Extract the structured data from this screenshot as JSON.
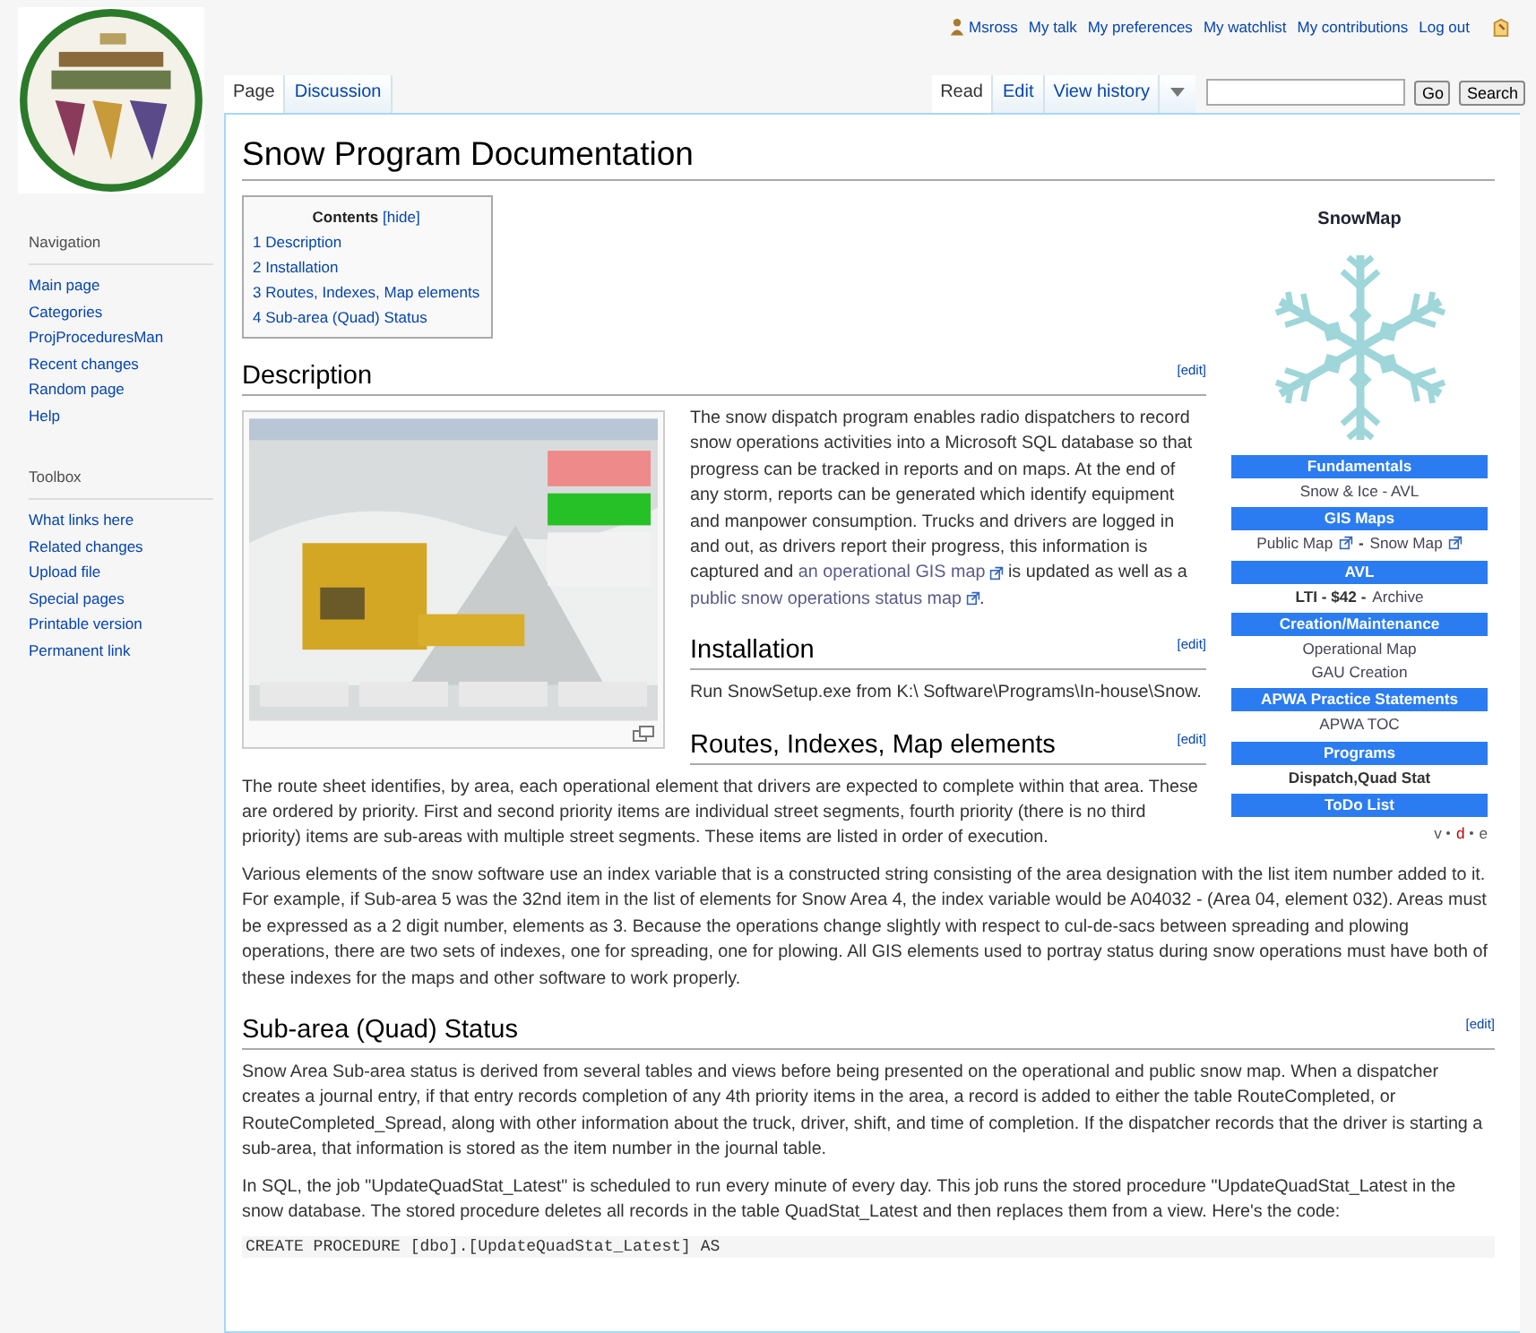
{
  "personal_menu": [
    {
      "label": "Msross",
      "kind": "user"
    },
    {
      "label": "My talk",
      "kind": "link"
    },
    {
      "label": "My preferences",
      "kind": "link"
    },
    {
      "label": "My watchlist",
      "kind": "link"
    },
    {
      "label": "My contributions",
      "kind": "link"
    },
    {
      "label": "Log out",
      "kind": "link"
    }
  ],
  "sidebar": [
    {
      "heading": "Navigation",
      "items": [
        "Main page",
        "Categories",
        "ProjProceduresMan",
        "Recent changes",
        "Random page",
        "Help"
      ]
    },
    {
      "heading": "Toolbox",
      "items": [
        "What links here",
        "Related changes",
        "Upload file",
        "Special pages",
        "Printable version",
        "Permanent link"
      ]
    }
  ],
  "page_tabs": [
    {
      "label": "Page",
      "selected": true
    },
    {
      "label": "Discussion",
      "selected": false
    }
  ],
  "view_tabs": [
    {
      "label": "Read",
      "selected": true
    },
    {
      "label": "Edit",
      "selected": false
    },
    {
      "label": "View history",
      "selected": false
    }
  ],
  "search": {
    "buttons": [
      "Go",
      "Search"
    ]
  },
  "title": "Snow Program Documentation",
  "toc": {
    "title": "Contents",
    "toggle": "[hide]",
    "items": [
      {
        "number": "1",
        "label": "Description"
      },
      {
        "number": "2",
        "label": "Installation"
      },
      {
        "number": "3",
        "label": "Routes, Indexes, Map elements"
      },
      {
        "number": "4",
        "label": "Sub-area (Quad) Status"
      }
    ]
  },
  "infobox": {
    "title": "SnowMap",
    "groups": [
      {
        "heading": "Fundamentals",
        "lines": [
          [
            {
              "text": "Snow & Ice - AVL",
              "kind": "link"
            }
          ]
        ]
      },
      {
        "heading": "GIS Maps",
        "lines": [
          [
            {
              "text": "Public Map",
              "kind": "external_link"
            },
            {
              "text": " - ",
              "kind": "text"
            },
            {
              "text": "Snow Map",
              "kind": "external_link"
            }
          ]
        ]
      },
      {
        "heading": "AVL",
        "lines": [
          [
            {
              "text": "LTI - $42 - ",
              "kind": "text"
            },
            {
              "text": "Archive",
              "kind": "link"
            }
          ]
        ]
      },
      {
        "heading": "Creation/Maintenance",
        "lines": [
          [
            {
              "text": "Operational Map",
              "kind": "link"
            }
          ],
          [
            {
              "text": "GAU Creation",
              "kind": "link"
            }
          ]
        ]
      },
      {
        "heading": "APWA Practice Statements",
        "lines": [
          [
            {
              "text": "APWA TOC",
              "kind": "link"
            }
          ]
        ]
      },
      {
        "heading": "Programs",
        "lines": [
          [
            {
              "text": "Dispatch,Quad Stat",
              "kind": "text"
            }
          ]
        ]
      },
      {
        "heading": "ToDo List"
      }
    ],
    "footer": [
      {
        "label": "v",
        "missing": false
      },
      {
        "label": "d",
        "missing": true
      },
      {
        "label": "e",
        "missing": false
      }
    ]
  },
  "sections": [
    {
      "heading": "Description",
      "edit": "[edit]",
      "figure": {
        "kind": "picture"
      },
      "blocks": [
        {
          "kind": "text",
          "parts": [
            {
              "text": "The snow dispatch program enables radio dispatchers to record snow operations activities into a Microsoft SQL database so that progress can be tracked in reports and on maps. At the end of any storm, reports can be generated which identify equipment and manpower consumption. Trucks and drivers are logged in and out, as drivers report their progress, this information is captured and ",
              "kind": "text"
            },
            {
              "text": "an operational GIS map",
              "kind": "external_link"
            },
            {
              "text": " is updated as well as a ",
              "kind": "text"
            },
            {
              "text": "public snow operations status map",
              "kind": "external_link"
            },
            {
              "text": ".",
              "kind": "text"
            }
          ]
        }
      ]
    },
    {
      "heading": "Installation",
      "edit": "[edit]",
      "blocks": [
        {
          "kind": "text",
          "parts": [
            {
              "text": "Run SnowSetup.exe from K:\\ Software\\Programs\\In-house\\Snow.",
              "kind": "text"
            }
          ]
        }
      ]
    },
    {
      "heading": "Routes, Indexes, Map elements",
      "edit": "[edit]",
      "blocks": [
        {
          "kind": "text",
          "parts": [
            {
              "text": "The route sheet identifies, by area, each operational element that drivers are expected to complete within that area. These are ordered by priority. First and second priority items are individual street segments, fourth priority (there is no third priority) items are sub-areas with multiple street segments. These items are listed in order of execution.",
              "kind": "text"
            }
          ]
        },
        {
          "kind": "text",
          "parts": [
            {
              "text": "Various elements of the snow software use an index variable that is a constructed string consisting of the area designation with the list item number added to it. For example, if Sub-area 5 was the 32nd item in the list of elements for Snow Area 4, the index variable would be A04032 - (Area 04, element 032). Areas must be expressed as a 2 digit number, elements as 3. Because the operations change slightly with respect to cul-de-sacs between spreading and plowing operations, there are two sets of indexes, one for spreading, one for plowing. All GIS elements used to portray status during snow operations must have both of these indexes for the maps and other software to work properly.",
              "kind": "text"
            }
          ]
        }
      ]
    },
    {
      "heading": "Sub-area (Quad) Status",
      "edit": "[edit]",
      "blocks": [
        {
          "kind": "text",
          "parts": [
            {
              "text": "Snow Area Sub-area status is derived from several tables and views before being presented on the operational and public snow map. When a dispatcher creates a journal entry, if that entry records completion of any 4th priority items in the area, a record is added to either the table RouteCompleted, or RouteCompleted_Spread, along with other information about the truck, driver, shift, and time of completion. If the dispatcher records that the driver is starting a sub-area, that information is stored as the item number in the journal table.",
              "kind": "text"
            }
          ]
        },
        {
          "kind": "text",
          "parts": [
            {
              "text": "In SQL, the job \"UpdateQuadStat_Latest\" is scheduled to run every minute of every day. This job runs the stored procedure \"UpdateQuadStat_Latest in the snow database. The stored procedure deletes all records in the table QuadStat_Latest and then replaces them from a view. Here's the code:",
              "kind": "text"
            }
          ]
        },
        {
          "kind": "code",
          "text": "CREATE PROCEDURE [dbo].[UpdateQuadStat_Latest] AS"
        }
      ]
    }
  ]
}
